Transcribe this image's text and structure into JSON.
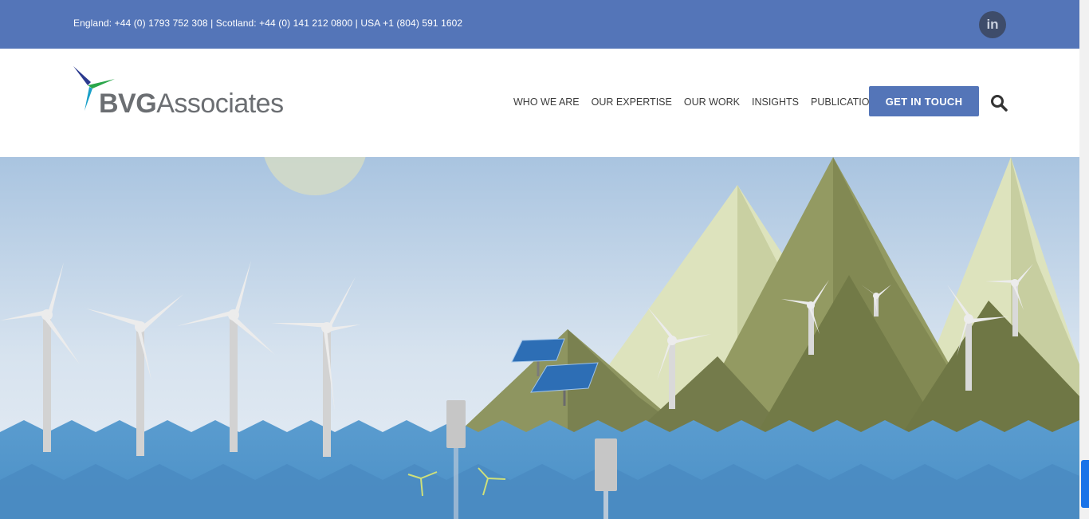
{
  "topbar": {
    "contact": "England: +44 (0) 1793 752 308 | Scotland: +44 (0) 141 212 0800 | USA +1 (804) 591 1602",
    "social_label": "in"
  },
  "logo": {
    "bold": "BVG",
    "light": "Associates"
  },
  "nav": {
    "items": [
      "WHO WE ARE",
      "OUR EXPERTISE",
      "OUR WORK",
      "INSIGHTS",
      "PUBLICATIONS"
    ],
    "cta": "GET IN TOUCH"
  },
  "colors": {
    "brand_blue": "#5475b8",
    "sea": "#4d94cb",
    "mountain": "#8a925a",
    "sky_top": "#a9c4e0"
  }
}
